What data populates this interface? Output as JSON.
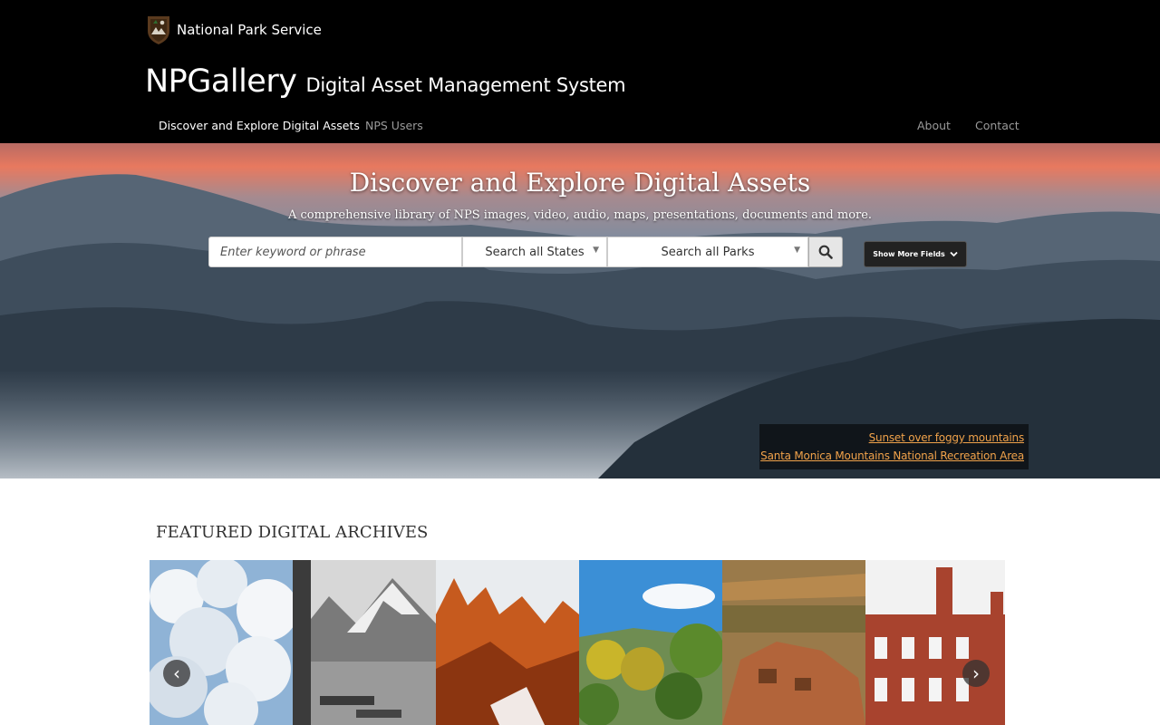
{
  "header": {
    "agency_name": "National Park Service",
    "brand_title": "NPGallery",
    "brand_subtitle": "Digital Asset Management System",
    "nav_left": [
      "Discover and Explore Digital Assets",
      "NPS Users"
    ],
    "nav_right": [
      "About",
      "Contact"
    ],
    "active_nav": "Discover and Explore Digital Assets"
  },
  "hero": {
    "title": "Discover and Explore Digital Assets",
    "tagline": "A comprehensive library of NPS images, video, audio, maps, presentations, documents and more.",
    "search": {
      "keyword_placeholder": "Enter keyword or phrase",
      "keyword_value": "",
      "states_selected": "Search all States",
      "parks_selected": "Search all Parks",
      "more_fields_label": "Show More Fields"
    },
    "photo_credit": {
      "caption": "Sunset over foggy mountains",
      "location": "Santa Monica Mountains National Recreation Area"
    }
  },
  "featured": {
    "title": "FEATURED DIGITAL ARCHIVES",
    "prev_label": "‹",
    "next_label": "›",
    "tiles": [
      "clouds",
      "black-and-white mountain lake",
      "red rock peaks",
      "aspen meadow",
      "pueblo ruins",
      "brick building"
    ]
  },
  "colors": {
    "header_bg": "#000000",
    "credit_link": "#f0a24a",
    "sunset": "#e8795f"
  },
  "icons": {
    "search": "search-icon",
    "more_fields": "chevron-down-icon"
  }
}
